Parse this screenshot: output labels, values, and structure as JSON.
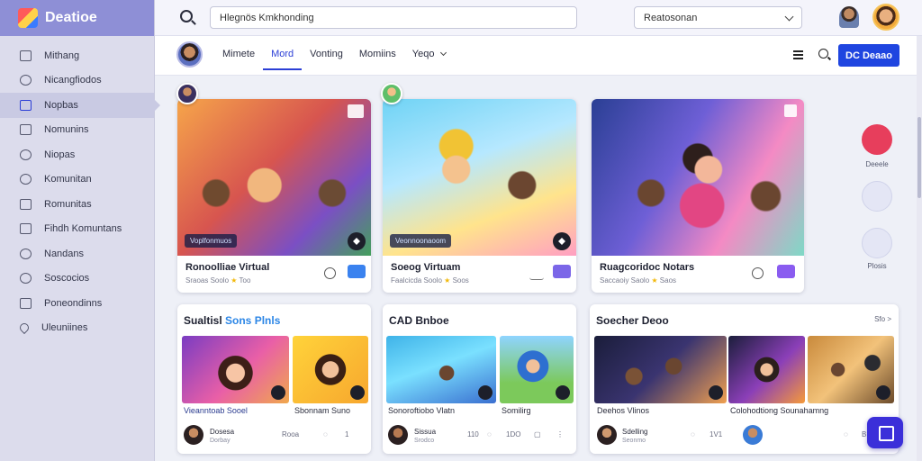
{
  "app": {
    "brand": "Deatioe"
  },
  "sidebar": {
    "items": [
      {
        "label": "Mithang",
        "icon": "grid-icon"
      },
      {
        "label": "Nicangfiodos",
        "icon": "people-icon"
      },
      {
        "label": "Nopbas",
        "icon": "page-icon",
        "active": true
      },
      {
        "label": "Nomunins",
        "icon": "doc-icon"
      },
      {
        "label": "Niopas",
        "icon": "heart-icon"
      },
      {
        "label": "Komunitan",
        "icon": "shield-icon"
      },
      {
        "label": "Romunitas",
        "icon": "box-icon"
      },
      {
        "label": "Fihdh Komuntans",
        "icon": "book-icon"
      },
      {
        "label": "Nandans",
        "icon": "badge-icon"
      },
      {
        "label": "Soscocios",
        "icon": "chat-icon"
      },
      {
        "label": "Poneondinns",
        "icon": "folder-icon"
      },
      {
        "label": "Uleuniines",
        "icon": "heart-outline-icon"
      }
    ]
  },
  "topbar": {
    "search_value": "Hlegnös Kmkhonding",
    "select_value": "Reatosonan"
  },
  "subbar": {
    "tabs": [
      {
        "label": "Mimete",
        "active": false
      },
      {
        "label": "Mord",
        "active": true
      },
      {
        "label": "Vonting",
        "active": false
      },
      {
        "label": "Momiins",
        "active": false
      },
      {
        "label": "Yeqo",
        "active": false,
        "dropdown": true
      }
    ],
    "primary_button": "DC Deaao"
  },
  "feature_cards": [
    {
      "title": "Ronoolliae Virtual",
      "meta": "Sraoas Soolo",
      "rating": "★",
      "meta2": "Too",
      "badge": "Voplfonmuos",
      "chip_color": "#3a82ef"
    },
    {
      "title": "Soeog Virtuam",
      "meta": "Faalcicda Soolo",
      "rating": "★",
      "meta2": "Soos",
      "badge": "Veonnoonaoom",
      "chip_color": "#7b66e8"
    },
    {
      "title": "Ruagcoridoc Notars",
      "meta": "Saccaoiy Saolo",
      "rating": "★",
      "meta2": "Saos",
      "badge": "",
      "chip_color": "#8a5cf0"
    }
  ],
  "right_column": [
    {
      "label": "Deeele",
      "icon": "heart-icon",
      "color": "#e73e5c"
    },
    {
      "label": "",
      "icon": "people-icon",
      "color": "#e4e6f5"
    },
    {
      "label": "Plosis",
      "icon": "person-icon",
      "color": "#e4e6f5"
    }
  ],
  "lower_cards": [
    {
      "title_part1": "Sualtisl ",
      "title_part2": "Sons Plnls",
      "more": "",
      "captions": [
        "Vieanntoab Sooel",
        "Sbonnam Suno"
      ],
      "author": "Dosesa",
      "author_sub": "Dorbay",
      "counts": [
        "Rooa",
        "1"
      ]
    },
    {
      "title_part1": "CAD Bnboe",
      "title_part2": "",
      "more": "",
      "captions": [
        "Sonoroftiobo Vlatn",
        "Somilirg"
      ],
      "author": "Sissua",
      "author_sub": "Srodco",
      "counts": [
        "110",
        "1DO"
      ]
    },
    {
      "title_part1": "Soecher Deoo",
      "title_part2": "",
      "more": "Sfo >",
      "captions": [
        "Deehos Vlinos",
        "Colohodtiong Sounahamng"
      ],
      "author": "Sdelling",
      "author_sub": "Seonmo",
      "counts": [
        "1V1",
        "B"
      ]
    }
  ]
}
